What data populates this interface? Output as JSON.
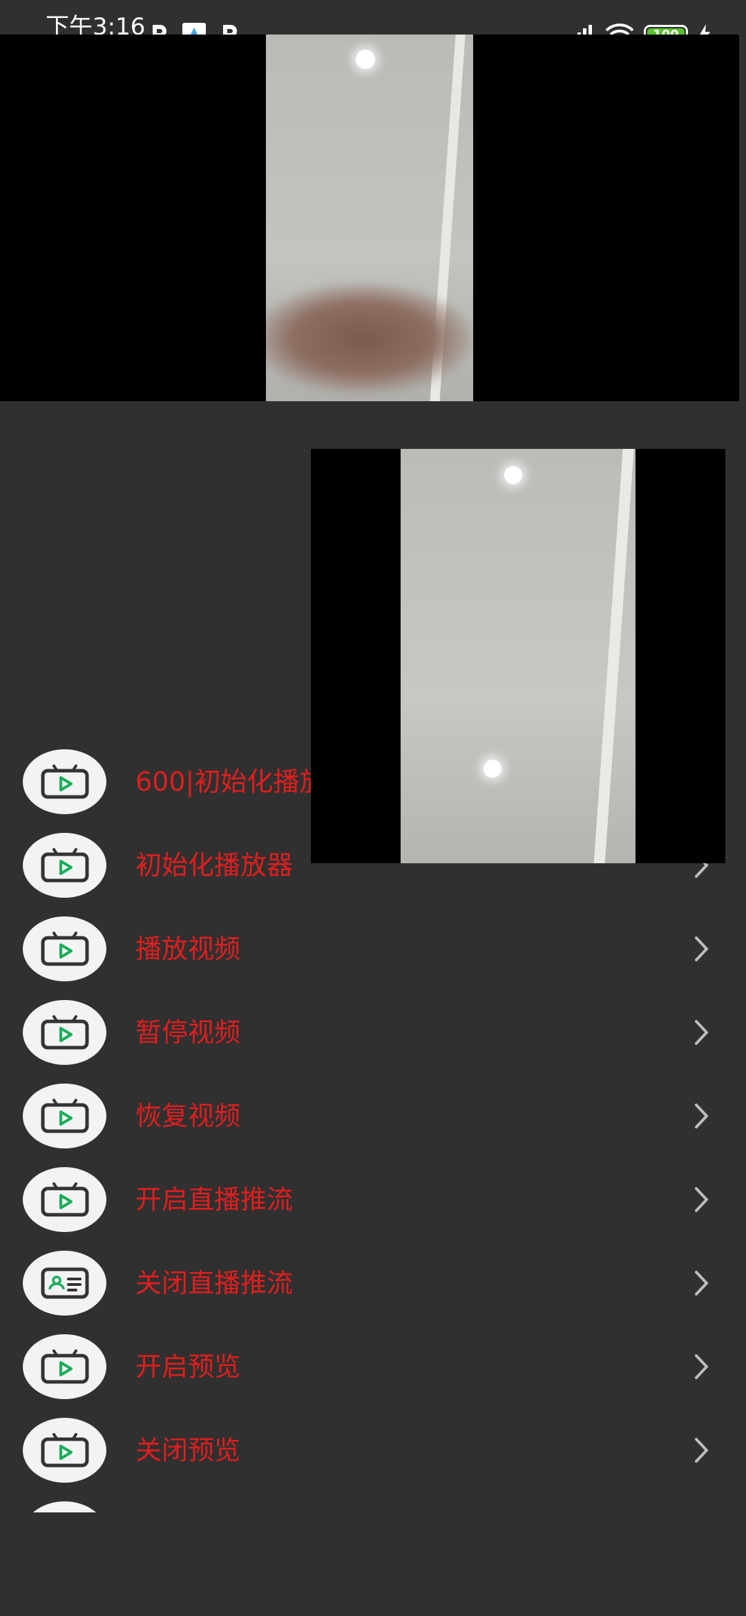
{
  "status_bar": {
    "time": "下午3:16",
    "notification_icons": [
      "p-app-icon",
      "photo-app-icon",
      "p-app-icon"
    ],
    "battery_level": "100",
    "battery_color": "#57c22d"
  },
  "main_preview": {
    "icon": "camera-preview"
  },
  "overlay_preview": {
    "icon": "camera-preview"
  },
  "colors": {
    "background": "#303030",
    "label": "#e01e1e",
    "icon_bg": "#f3f3f3",
    "icon_accent": "#1aad5a",
    "chevron": "#bdbdbd"
  },
  "menu": {
    "items": [
      {
        "label": "600|初始化播放器成功",
        "icon": "tv-play-icon"
      },
      {
        "label": "初始化播放器",
        "icon": "tv-play-icon"
      },
      {
        "label": "播放视频",
        "icon": "tv-play-icon"
      },
      {
        "label": "暂停视频",
        "icon": "tv-play-icon"
      },
      {
        "label": "恢复视频",
        "icon": "tv-play-icon"
      },
      {
        "label": "开启直播推流",
        "icon": "tv-play-icon"
      },
      {
        "label": "关闭直播推流",
        "icon": "id-card-icon"
      },
      {
        "label": "开启预览",
        "icon": "tv-play-icon"
      },
      {
        "label": "关闭预览",
        "icon": "tv-play-icon"
      }
    ]
  }
}
